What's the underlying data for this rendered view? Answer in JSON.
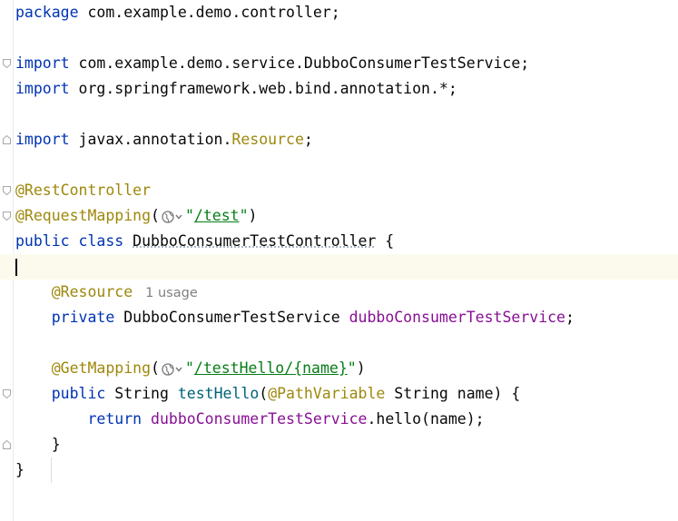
{
  "editor": {
    "usage_hint": "1 usage",
    "lines": {
      "l1": {
        "kw": "package",
        "rest": " com.example.demo.controller;"
      },
      "l3": {
        "kw": "import",
        "rest": " com.example.demo.service.DubboConsumerTestService;"
      },
      "l4": {
        "kw": "import",
        "rest": " org.springframework.web.bind.annotation.*;"
      },
      "l6": {
        "kw": "import",
        "pre": " javax.annotation.",
        "cls": "Resource",
        "post": ";"
      },
      "l8": {
        "ann": "@RestController"
      },
      "l9": {
        "ann": "@RequestMapping",
        "open": "(",
        "q1": "\"",
        "url": "/test",
        "q2": "\"",
        "close": ")"
      },
      "l10": {
        "kw1": "public",
        "sp1": " ",
        "kw2": "class",
        "sp2": " ",
        "name": "DubboConsumerTestController",
        "brace": " {"
      },
      "l12": {
        "ann": "@Resource"
      },
      "l13": {
        "kw": "private",
        "type": " DubboConsumerTestService ",
        "field": "dubboConsumerTestService",
        "end": ";"
      },
      "l15": {
        "ann": "@GetMapping",
        "open": "(",
        "q1": "\"",
        "url_a": "/testHello/",
        "url_b": "{name}",
        "q2": "\"",
        "close": ")"
      },
      "l16": {
        "kw": "public",
        "type": " String ",
        "method": "testHello",
        "open": "(",
        "ann": "@PathVariable",
        "params": " String name) {"
      },
      "l17": {
        "kw": "return",
        "sp": " ",
        "field": "dubboConsumerTestService",
        "call": ".hello(name);"
      },
      "l18": {
        "text": "}"
      },
      "l19": {
        "text": "}"
      }
    }
  }
}
